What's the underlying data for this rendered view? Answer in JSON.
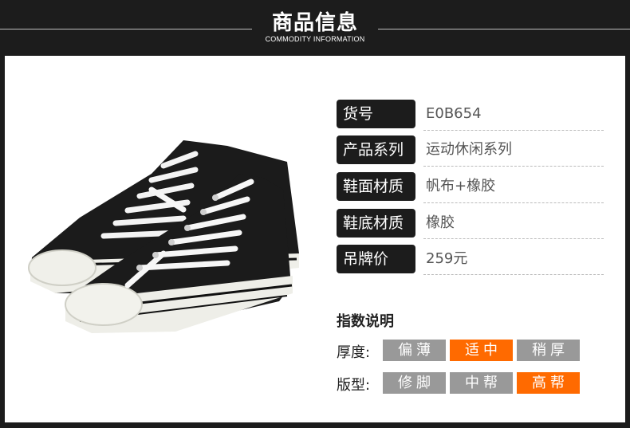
{
  "header": {
    "title": "商品信息",
    "subtitle": "COMMODITY INFORMATION"
  },
  "specs": [
    {
      "label": "货号",
      "value": "E0B654"
    },
    {
      "label": "产品系列",
      "value": "运动休闲系列"
    },
    {
      "label": "鞋面材质",
      "value": "帆布+橡胶"
    },
    {
      "label": "鞋底材质",
      "value": "橡胶"
    },
    {
      "label": "吊牌价",
      "value": "259元"
    }
  ],
  "index_title": "指数说明",
  "thickness": {
    "label": "厚度:",
    "options": [
      "偏薄",
      "适中",
      "稍厚"
    ],
    "selected": "适中"
  },
  "shape": {
    "label": "版型:",
    "options": [
      "修脚",
      "中帮",
      "高帮"
    ],
    "selected": "高帮"
  },
  "colors": {
    "active": "#ff6a00",
    "inactive": "#999999",
    "dark": "#1c1c1c"
  }
}
